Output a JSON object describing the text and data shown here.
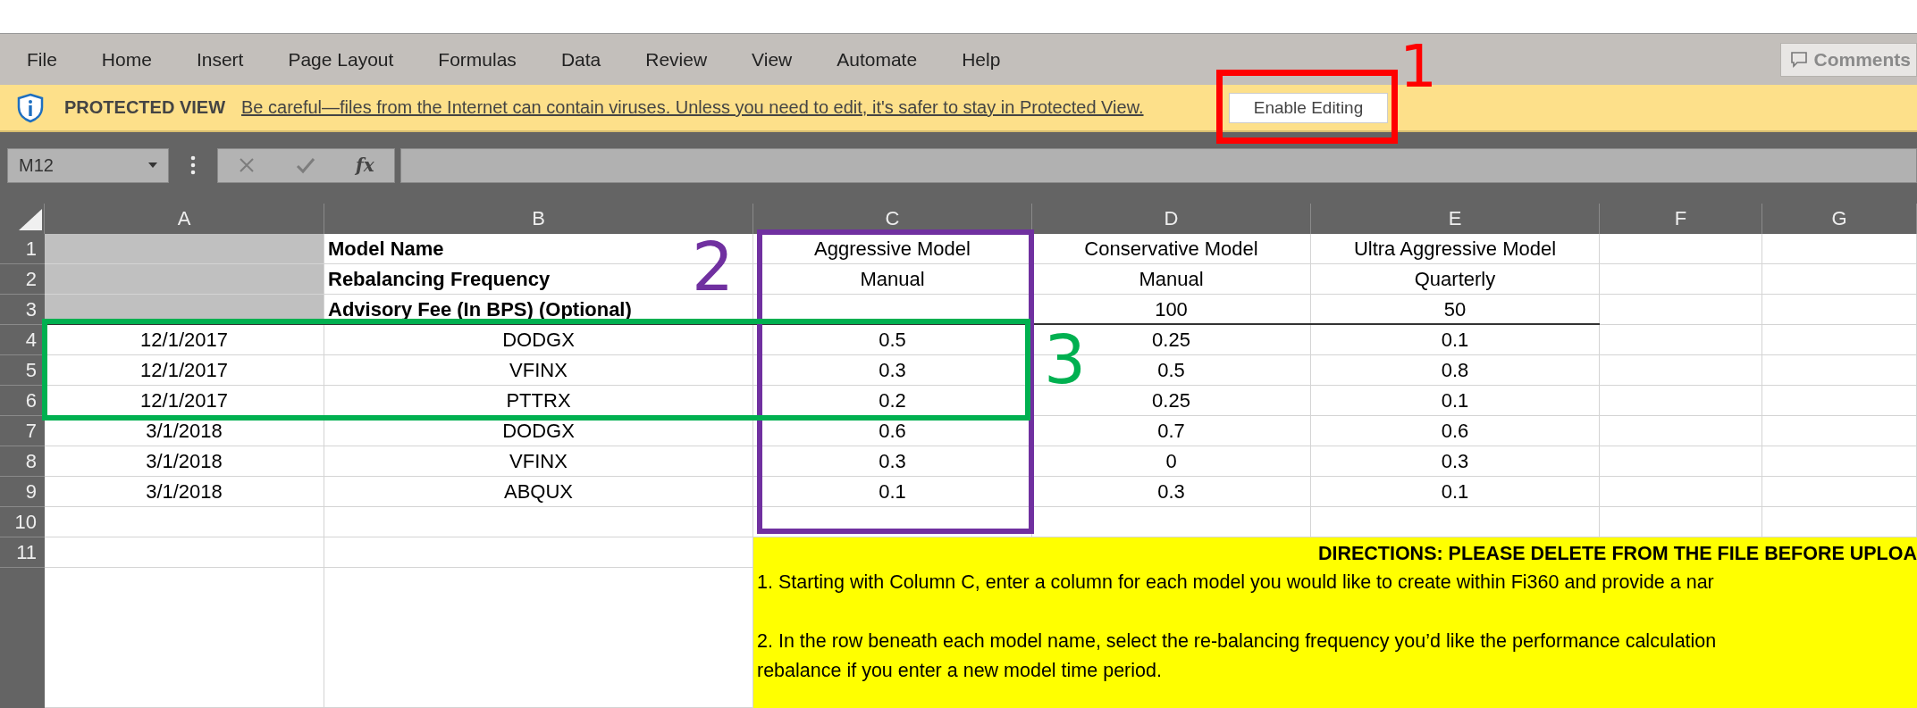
{
  "menu_bar": {
    "tabs": [
      "File",
      "Home",
      "Insert",
      "Page Layout",
      "Formulas",
      "Data",
      "Review",
      "View",
      "Automate",
      "Help"
    ],
    "comments_button": "Comments"
  },
  "protected_view": {
    "title": "PROTECTED VIEW",
    "message": "Be careful—files from the Internet can contain viruses. Unless you need to edit, it's safer to stay in Protected View.",
    "button": "Enable Editing"
  },
  "formula_bar": {
    "name_box": "M12",
    "function_label": "fx"
  },
  "sheet": {
    "columns": [
      "A",
      "B",
      "C",
      "D",
      "E",
      "F",
      "G"
    ],
    "rows": [
      {
        "number": "1",
        "cells": [
          {
            "shaded": true
          },
          {
            "text": "Model Name",
            "bold": true
          },
          {
            "text": "Aggressive Model"
          },
          {
            "text": "Conservative Model"
          },
          {
            "text": "Ultra Aggressive Model"
          }
        ]
      },
      {
        "number": "2",
        "cells": [
          {
            "shaded": true
          },
          {
            "text": "Rebalancing Frequency",
            "bold": true
          },
          {
            "text": "Manual"
          },
          {
            "text": "Manual"
          },
          {
            "text": "Quarterly"
          }
        ]
      },
      {
        "number": "3",
        "bottom_rule": true,
        "cells": [
          {
            "shaded": true
          },
          {
            "text": "Advisory Fee (In BPS) (Optional)",
            "bold": true
          },
          {},
          {
            "text": "100"
          },
          {
            "text": "50"
          }
        ]
      },
      {
        "number": "4",
        "cells": [
          {
            "text": "12/1/2017"
          },
          {
            "text": "DODGX"
          },
          {
            "text": "0.5"
          },
          {
            "text": "0.25"
          },
          {
            "text": "0.1"
          }
        ]
      },
      {
        "number": "5",
        "cells": [
          {
            "text": "12/1/2017"
          },
          {
            "text": "VFINX"
          },
          {
            "text": "0.3"
          },
          {
            "text": "0.5"
          },
          {
            "text": "0.8"
          }
        ]
      },
      {
        "number": "6",
        "cells": [
          {
            "text": "12/1/2017"
          },
          {
            "text": "PTTRX"
          },
          {
            "text": "0.2"
          },
          {
            "text": "0.25"
          },
          {
            "text": "0.1"
          }
        ]
      },
      {
        "number": "7",
        "cells": [
          {
            "text": "3/1/2018"
          },
          {
            "text": "DODGX"
          },
          {
            "text": "0.6"
          },
          {
            "text": "0.7"
          },
          {
            "text": "0.6"
          }
        ]
      },
      {
        "number": "8",
        "cells": [
          {
            "text": "3/1/2018"
          },
          {
            "text": "VFINX"
          },
          {
            "text": "0.3"
          },
          {
            "text": "0"
          },
          {
            "text": "0.3"
          }
        ]
      },
      {
        "number": "9",
        "cells": [
          {
            "text": "3/1/2018"
          },
          {
            "text": "ABQUX"
          },
          {
            "text": "0.1"
          },
          {
            "text": "0.3"
          },
          {
            "text": "0.1"
          }
        ]
      },
      {
        "number": "10",
        "cells": []
      },
      {
        "number": "11",
        "cells": []
      }
    ]
  },
  "directions": {
    "heading": "DIRECTIONS: PLEASE DELETE FROM THE FILE BEFORE UPLOA",
    "paragraphs": [
      [
        "1.  Starting with Column C, enter a column for each model you would like to create within Fi360 and provide a nar"
      ],
      [
        "2.  In the row beneath each model name, select the re-balancing frequency you’d like the performance calculation",
        "rebalance if you enter a new model time period."
      ]
    ]
  },
  "annotations": [
    {
      "number": "1",
      "color": "#ff0000"
    },
    {
      "number": "2",
      "color": "#7030a0"
    },
    {
      "number": "3",
      "color": "#00b050"
    }
  ]
}
